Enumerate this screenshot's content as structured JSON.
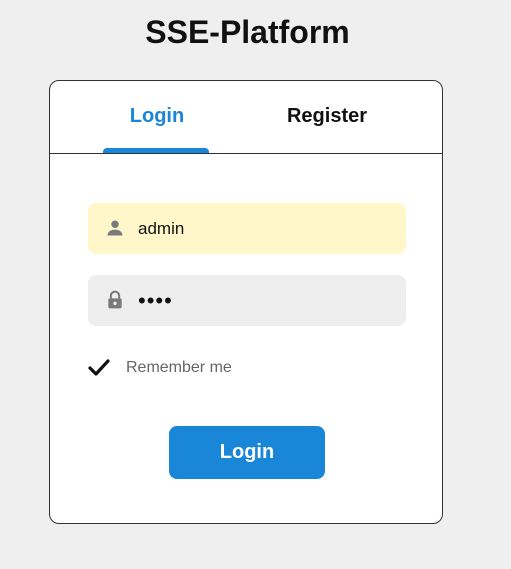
{
  "app": {
    "title": "SSE-Platform"
  },
  "tabs": {
    "login_label": "Login",
    "register_label": "Register",
    "active": "login"
  },
  "form": {
    "username": {
      "value": "admin",
      "icon": "user-icon"
    },
    "password": {
      "value": "••••",
      "icon": "lock-icon"
    },
    "remember": {
      "label": "Remember me",
      "checked": true,
      "icon": "checkmark-icon"
    },
    "submit_label": "Login"
  },
  "colors": {
    "accent": "#1a86d8",
    "autofill_bg": "#fff7c9",
    "field_bg": "#eeeeee",
    "page_bg": "#efefef"
  }
}
